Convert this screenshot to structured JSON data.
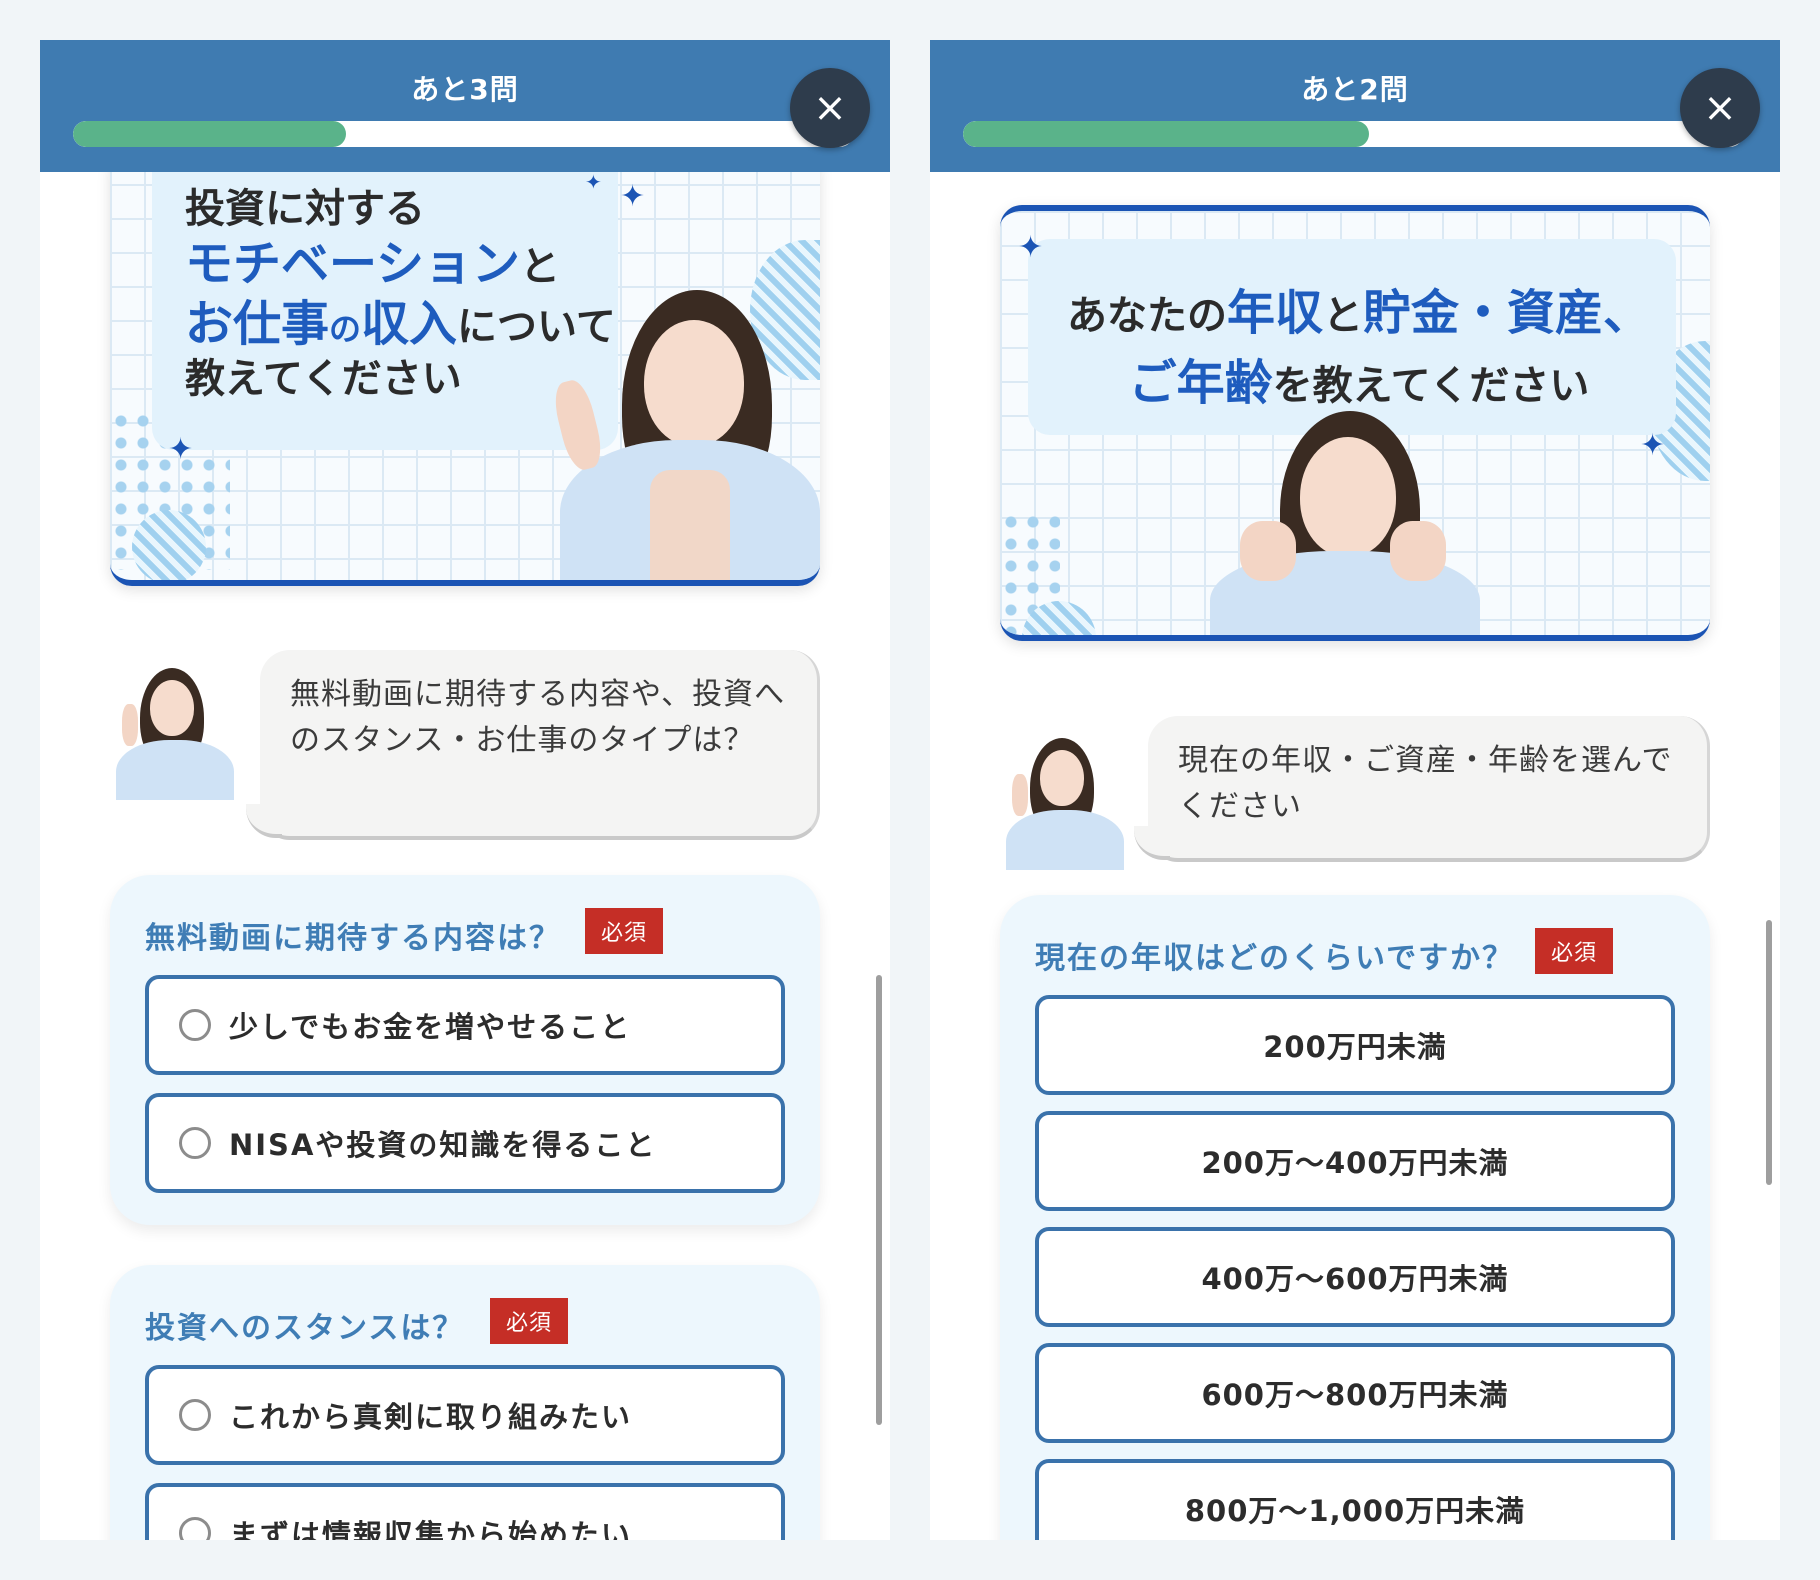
{
  "left": {
    "remaining": "あと3問",
    "progress": 0.35,
    "banner": {
      "line1": "投資に対する",
      "line2_hl": "モチベーション",
      "line2_rest": "と",
      "line3_hl1": "お仕事",
      "line3_mid": "の",
      "line3_hl2": "収入",
      "line3_rest": "について",
      "line4": "教えてください"
    },
    "chat": "無料動画に期待する内容や、投資へのスタンス・お仕事のタイプは？",
    "questions": [
      {
        "title": "無料動画に期待する内容は？",
        "required": "必須",
        "options": [
          "少しでもお金を増やせること",
          "NISAや投資の知識を得ること"
        ]
      },
      {
        "title": "投資へのスタンスは？",
        "required": "必須",
        "options": [
          "これから真剣に取り組みたい",
          "まずは情報収集から始めたい"
        ]
      }
    ]
  },
  "right": {
    "remaining": "あと2問",
    "progress": 0.52,
    "banner": {
      "pre": "あなたの",
      "hl1": "年収",
      "mid1": "と",
      "hl2": "貯金・資産、",
      "hl3": "ご年齢",
      "rest": "を教えてください"
    },
    "chat": "現在の年収・ご資産・年齢を選んでください",
    "question": {
      "title": "現在の年収はどのくらいですか？",
      "required": "必須",
      "options": [
        "200万円未満",
        "200万〜400万円未満",
        "400万〜600万円未満",
        "600万〜800万円未満",
        "800万〜1,000万円未満"
      ]
    }
  },
  "close_label": "×",
  "sparkle": "✦",
  "colors": {
    "header": "#3f7bb1",
    "progress": "#5ab38a",
    "accent": "#1e5cbe",
    "required": "#c52e26",
    "option_border": "#3a72ab"
  }
}
